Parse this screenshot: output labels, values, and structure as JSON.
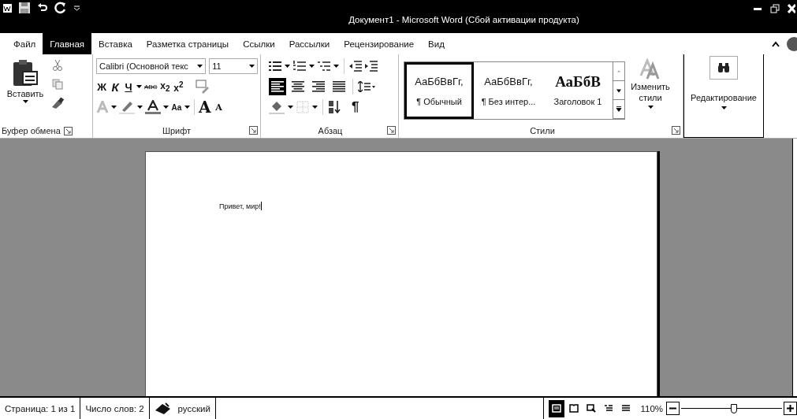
{
  "title_bar": {
    "title": "Документ1 - Microsoft Word (Сбой активации продукта)"
  },
  "tabs": [
    {
      "label": "Файл",
      "selected": false
    },
    {
      "label": "Главная",
      "selected": true
    },
    {
      "label": "Вставка",
      "selected": false
    },
    {
      "label": "Разметка страницы",
      "selected": false
    },
    {
      "label": "Ссылки",
      "selected": false
    },
    {
      "label": "Рассылки",
      "selected": false
    },
    {
      "label": "Рецензирование",
      "selected": false
    },
    {
      "label": "Вид",
      "selected": false
    }
  ],
  "ribbon": {
    "clipboard": {
      "paste_label": "Вставить",
      "group_label": "Буфер обмена"
    },
    "font": {
      "font_name": "Calibri (Основной текс",
      "font_size": "11",
      "format_buttons": [
        "Ж",
        "К",
        "Ч",
        "ABC",
        "x$_{2}$",
        "x$^{2}$"
      ],
      "case_label": "Aa",
      "grow_label": "A",
      "shrink_label": "A",
      "group_label": "Шрифт"
    },
    "paragraph": {
      "alignments": [
        {
          "selected": true
        },
        {
          "selected": false
        },
        {
          "selected": false
        },
        {
          "selected": false
        }
      ],
      "pilcrow": "¶",
      "group_label": "Абзац"
    },
    "styles": {
      "items": [
        {
          "kind": "normal",
          "preview": "АаБбВвГг,",
          "name": "¶ Обычный",
          "selected": true
        },
        {
          "kind": "normal",
          "preview": "АаБбВвГг,",
          "name": "¶ Без интер...",
          "selected": false
        },
        {
          "kind": "heading",
          "preview": "АаБбВ",
          "name": "Заголовок 1",
          "selected": false
        }
      ],
      "change_styles": "Изменить стили",
      "group_label": "Стили"
    },
    "editing": {
      "label": "Редактирование"
    }
  },
  "document": {
    "text": "Привет, мир!"
  },
  "status_bar": {
    "page": "Страница: 1 из 1",
    "words": "Число слов: 2",
    "language": "русский",
    "views": [
      {
        "selected": true
      },
      {
        "selected": false
      },
      {
        "selected": false
      },
      {
        "selected": false
      },
      {
        "selected": false
      }
    ],
    "zoom": "110%",
    "zoom_slider": {
      "level": 0.52
    }
  }
}
